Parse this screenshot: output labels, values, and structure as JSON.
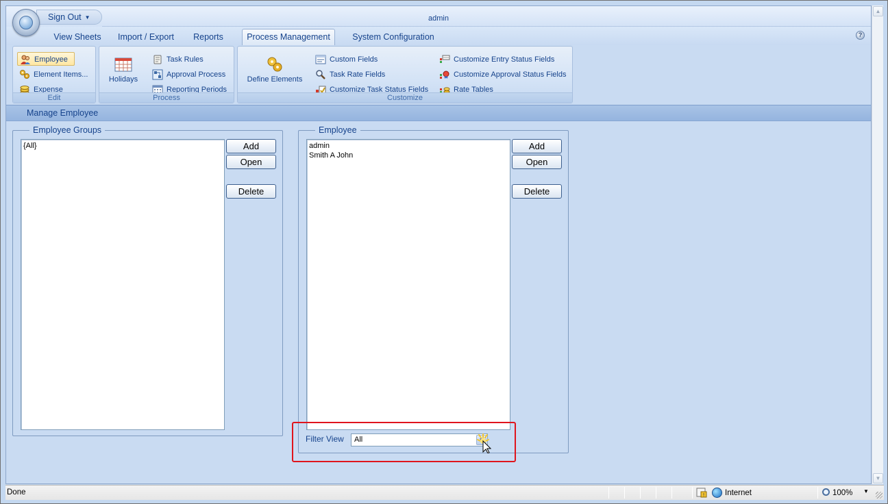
{
  "titlebar": {
    "signout_label": "Sign Out",
    "user": "admin"
  },
  "tabs": [
    {
      "label": "View Sheets"
    },
    {
      "label": "Import / Export"
    },
    {
      "label": "Reports"
    },
    {
      "label": "Process Management"
    },
    {
      "label": "System Configuration"
    }
  ],
  "active_tab": "Process Management",
  "ribbon": {
    "edit": {
      "label": "Edit",
      "items": [
        {
          "label": "Employee",
          "icon": "users-icon"
        },
        {
          "label": "Element Items...",
          "icon": "gears-icon"
        },
        {
          "label": "Expense",
          "icon": "coins-icon"
        }
      ]
    },
    "process": {
      "label": "Process",
      "holidays": "Holidays",
      "items": [
        {
          "label": "Task Rules",
          "icon": "scroll-icon"
        },
        {
          "label": "Approval Process",
          "icon": "approval-icon"
        },
        {
          "label": "Reporting Periods",
          "icon": "calendar-icon"
        }
      ]
    },
    "customize": {
      "label": "Customize",
      "define_elements": "Define Elements",
      "items": [
        {
          "label": "Custom Fields",
          "icon": "form-icon"
        },
        {
          "label": "Task Rate Fields",
          "icon": "magnifier-icon"
        },
        {
          "label": "Customize Task Status Fields",
          "icon": "task-status-icon"
        },
        {
          "label": "Customize Entry Status Fields",
          "icon": "entry-status-icon"
        },
        {
          "label": "Customize Approval Status Fields",
          "icon": "approval-status-icon"
        },
        {
          "label": "Rate Tables",
          "icon": "rate-table-icon"
        }
      ]
    }
  },
  "section_title": "Manage Employee",
  "groups_panel": {
    "legend": "Employee Groups",
    "items": [
      "{All}"
    ],
    "add": "Add",
    "open": "Open",
    "delete": "Delete"
  },
  "employee_panel": {
    "legend": "Employee",
    "items": [
      "admin",
      "Smith A  John"
    ],
    "add": "Add",
    "open": "Open",
    "delete": "Delete",
    "filter_label": "Filter View",
    "filter_value": "All"
  },
  "statusbar": {
    "status": "Done",
    "zone": "Internet",
    "zoom": "100%"
  },
  "colors": {
    "highlight": "#e0141c",
    "accent": "#15428b",
    "background": "#c9dbf2"
  }
}
